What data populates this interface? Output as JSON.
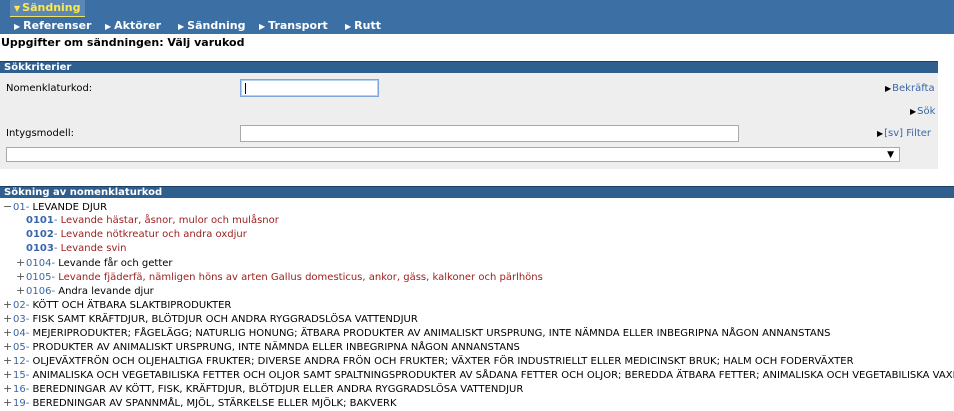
{
  "top_tab": {
    "label": "Sändning"
  },
  "nav": [
    {
      "label": "Referenser"
    },
    {
      "label": "Aktörer"
    },
    {
      "label": "Sändning"
    },
    {
      "label": "Transport"
    },
    {
      "label": "Rutt"
    }
  ],
  "page_title": "Uppgifter om sändningen: Välj varukod",
  "search": {
    "header": "Sökkriterier",
    "nomenclature_label": "Nomenklaturkod:",
    "nomenclature_value": "",
    "confirm_link": "Bekräfta",
    "search_link": "Sök",
    "certificate_label": "Intygsmodell:",
    "certificate_value": "",
    "filter_link": "[sv] Filter",
    "dropdown_value": ""
  },
  "tree": {
    "header": "Sökning av nomenklaturkod",
    "rows": [
      {
        "toggle": "−",
        "code": "01",
        "sep": "- ",
        "desc": "LEVANDE DJUR",
        "indent": 0,
        "style": "normal"
      },
      {
        "toggle": "",
        "code": "0101",
        "sep": "- ",
        "desc": "Levande hästar, åsnor, mulor och mulåsnor",
        "indent": 1,
        "style": "leaf"
      },
      {
        "toggle": "",
        "code": "0102",
        "sep": "- ",
        "desc": "Levande nötkreatur och andra oxdjur",
        "indent": 1,
        "style": "leaf"
      },
      {
        "toggle": "",
        "code": "0103",
        "sep": "- ",
        "desc": "Levande svin",
        "indent": 1,
        "style": "leaf"
      },
      {
        "toggle": "+",
        "code": "0104",
        "sep": "- ",
        "desc": "Levande får och getter",
        "indent": 1,
        "style": "normal"
      },
      {
        "toggle": "+",
        "code": "0105",
        "sep": "- ",
        "desc": "Levande fjäderfä, nämligen höns av arten Gallus domesticus, ankor, gäss, kalkoner och pärlhöns",
        "indent": 1,
        "style": "red"
      },
      {
        "toggle": "+",
        "code": "0106",
        "sep": "- ",
        "desc": "Andra levande djur",
        "indent": 1,
        "style": "normal"
      },
      {
        "toggle": "+",
        "code": "02",
        "sep": "- ",
        "desc": "KÖTT OCH ÄTBARA SLAKTBIPRODUKTER",
        "indent": 0,
        "style": "normal"
      },
      {
        "toggle": "+",
        "code": "03",
        "sep": "- ",
        "desc": "FISK SAMT KRÄFTDJUR, BLÖTDJUR OCH ANDRA RYGGRADSLÖSA VATTENDJUR",
        "indent": 0,
        "style": "normal"
      },
      {
        "toggle": "+",
        "code": "04",
        "sep": "- ",
        "desc": "MEJERIPRODUKTER; FÅGELÄGG; NATURLIG HONUNG; ÄTBARA PRODUKTER AV ANIMALISKT URSPRUNG, INTE NÄMNDA ELLER INBEGRIPNA NÅGON ANNANSTANS",
        "indent": 0,
        "style": "normal"
      },
      {
        "toggle": "+",
        "code": "05",
        "sep": "- ",
        "desc": "PRODUKTER AV ANIMALISKT URSPRUNG, INTE NÄMNDA ELLER INBEGRIPNA NÅGON ANNANSTANS",
        "indent": 0,
        "style": "normal"
      },
      {
        "toggle": "+",
        "code": "12",
        "sep": "- ",
        "desc": "OLJEVÄXTFRÖN OCH OLJEHALTIGA FRUKTER; DIVERSE ANDRA FRÖN OCH FRUKTER; VÄXTER FÖR INDUSTRIELLT ELLER MEDICINSKT BRUK; HALM OCH FODERVÄXTER",
        "indent": 0,
        "style": "normal"
      },
      {
        "toggle": "+",
        "code": "15",
        "sep": "- ",
        "desc": "ANIMALISKA OCH VEGETABILISKA FETTER OCH OLJOR SAMT SPALTNINGSPRODUKTER AV SÅDANA FETTER OCH OLJOR; BEREDDA ÄTBARA FETTER; ANIMALISKA OCH VEGETABILISKA VAXER",
        "indent": 0,
        "style": "normal"
      },
      {
        "toggle": "+",
        "code": "16",
        "sep": "- ",
        "desc": "BEREDNINGAR AV KÖTT, FISK, KRÄFTDJUR, BLÖTDJUR ELLER ANDRA RYGGRADSLÖSA VATTENDJUR",
        "indent": 0,
        "style": "normal"
      },
      {
        "toggle": "+",
        "code": "19",
        "sep": "- ",
        "desc": "BEREDNINGAR AV SPANNMÅL, MJÖL, STÄRKELSE ELLER MJÖLK; BAKVERK",
        "indent": 0,
        "style": "normal"
      }
    ]
  }
}
